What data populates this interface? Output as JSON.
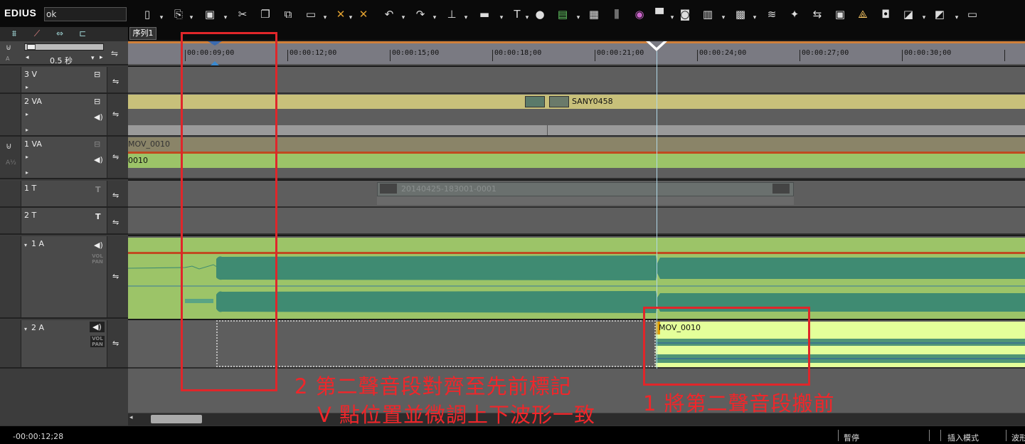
{
  "app": {
    "brand": "EDIUS",
    "project_name": "ok"
  },
  "toolbar_icons": [
    "new-icon",
    "open-icon",
    "save-icon",
    "cut-icon",
    "copy-icon",
    "paste-icon",
    "link-icon",
    "delete-icon",
    "ripple-delete-icon",
    "undo-icon",
    "redo-icon",
    "set-in-icon",
    "filmstrip-icon",
    "title-icon",
    "mic-icon",
    "color-bars-icon",
    "multicam-icon",
    "mixer-icon",
    "color-wheel-icon",
    "render-icon",
    "capture-icon",
    "split-icon",
    "group-icon",
    "waveform-icon",
    "marker-icon",
    "sync-icon",
    "layout-icon",
    "keyframe-icon",
    "snapshot-icon",
    "fade-in-icon",
    "fade-out-icon",
    "export-icon"
  ],
  "sequence_tab": "序列1",
  "scale": "0.5 秒",
  "ruler_ticks": [
    "00:00:09;00",
    "00:00:12;00",
    "00:00:15;00",
    "00:00:18;00",
    "00:00:21;00",
    "00:00:24;00",
    "00:00:27;00",
    "00:00:30;00"
  ],
  "tracks": {
    "v3": "3 V",
    "va2": "2 VA",
    "va1": "1 VA",
    "t1": "1 T",
    "t2": "2 T",
    "a1": "1 A",
    "a2": "2 A",
    "vol_pan": "VOL PAN"
  },
  "clips": {
    "va2_clip": "SANY0458",
    "va1_video": "MOV_0010",
    "va1_audio": "0010",
    "title_clip": "20140425-183001-0001",
    "a2_clip": "MOV_0010"
  },
  "annotations": {
    "note1": "1 將第二聲音段搬前",
    "note2_line1": "2 第二聲音段對齊至先前標記",
    "note2_line2": "V 點位置並微調上下波形一致"
  },
  "status": {
    "timecode": "-00:00:12;28",
    "state": "暫停",
    "mode": "插入模式",
    "wave": "波形"
  },
  "colors": {
    "annotation": "#e0262a",
    "clip_yellow": "#c8c07a",
    "clip_green": "#9cc468",
    "waveform": "#3f8b72",
    "cursor": "#4fd0e0"
  }
}
